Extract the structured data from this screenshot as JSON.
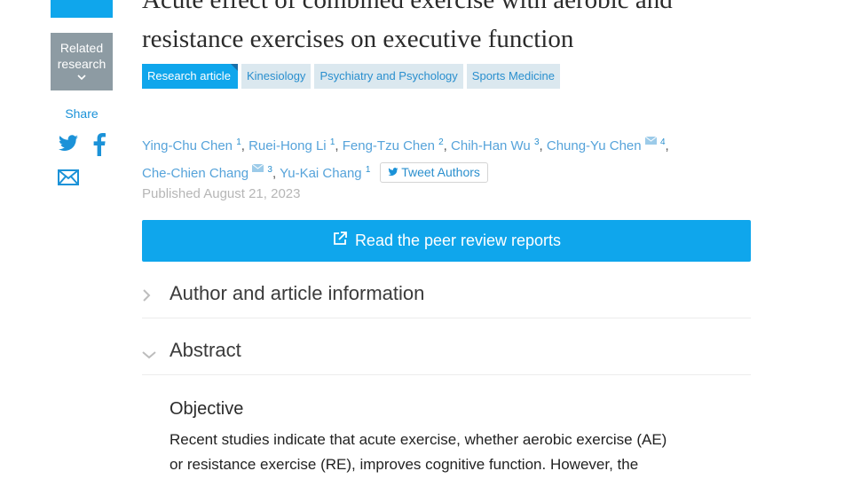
{
  "sidebar": {
    "related_label": "Related research",
    "share_label": "Share",
    "icons": [
      "twitter-icon",
      "facebook-icon",
      "email-icon"
    ]
  },
  "article": {
    "title": "Acute effect of combined exercise with aerobic and resistance exercises on executive function",
    "tags": [
      "Research article",
      "Kinesiology",
      "Psychiatry and Psychology",
      "Sports Medicine"
    ],
    "authors": [
      {
        "name": "Ying-Chu Chen",
        "aff": "1",
        "mail": false
      },
      {
        "name": "Ruei-Hong Li",
        "aff": "1",
        "mail": false
      },
      {
        "name": "Feng-Tzu Chen",
        "aff": "2",
        "mail": false
      },
      {
        "name": "Chih-Han Wu",
        "aff": "3",
        "mail": false
      },
      {
        "name": "Chung-Yu Chen",
        "aff": "4",
        "mail": true
      },
      {
        "name": "Che-Chien Chang",
        "aff": "3",
        "mail": true
      },
      {
        "name": "Yu-Kai Chang",
        "aff": "1",
        "mail": false
      }
    ],
    "tweet_authors_label": "Tweet Authors",
    "published": "Published August 21, 2023",
    "peer_review_button": "Read the peer review reports",
    "sections": {
      "author_info": "Author and article information",
      "abstract": "Abstract"
    },
    "objective_heading": "Objective",
    "abstract_line1": "Recent studies indicate that acute exercise, whether aerobic exercise (AE)",
    "abstract_line2": "or resistance exercise (RE), improves cognitive function. However, the"
  },
  "colors": {
    "accent": "#0fa6ec",
    "link": "#56a3da",
    "tag_bg": "#dbe8ef",
    "related_bg": "#8d9ba3"
  }
}
